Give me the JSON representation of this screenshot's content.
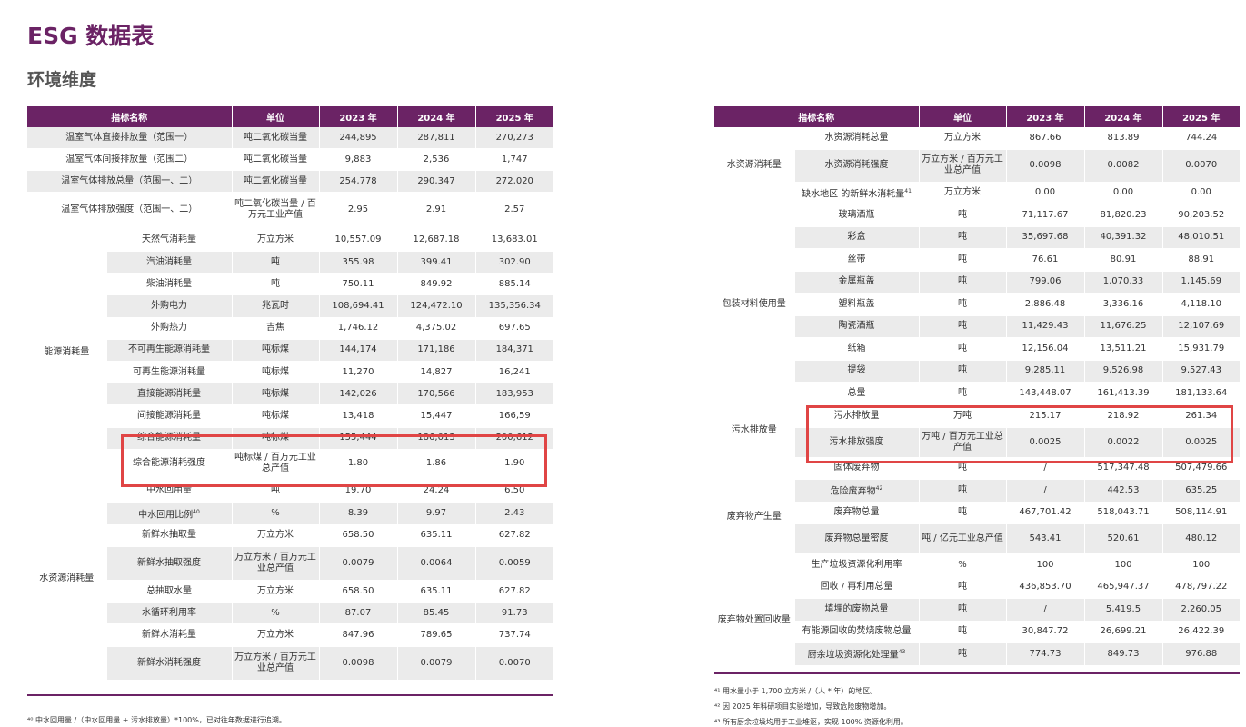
{
  "title": "ESG 数据表",
  "subtitle": "环境维度",
  "headers": {
    "indicator": "指标名称",
    "unit": "单位",
    "y2023": "2023 年",
    "y2024": "2024 年",
    "y2025": "2025 年"
  },
  "left": {
    "ghg": [
      {
        "name": "温室气体直接排放量（范围一）",
        "unit": "吨二氧化碳当量",
        "v2023": "244,895",
        "v2024": "287,811",
        "v2025": "270,273"
      },
      {
        "name": "温室气体间接排放量（范围二）",
        "unit": "吨二氧化碳当量",
        "v2023": "9,883",
        "v2024": "2,536",
        "v2025": "1,747"
      },
      {
        "name": "温室气体排放总量（范围一、二）",
        "unit": "吨二氧化碳当量",
        "v2023": "254,778",
        "v2024": "290,347",
        "v2025": "272,020"
      },
      {
        "name": "温室气体排放强度（范围一、二）",
        "unit": "吨二氧化碳当量 / 百万元工业产值",
        "v2023": "2.95",
        "v2024": "2.91",
        "v2025": "2.57"
      }
    ],
    "energy_group": "能源消耗量",
    "energy": [
      {
        "name": "天然气消耗量",
        "unit": "万立方米",
        "v2023": "10,557.09",
        "v2024": "12,687.18",
        "v2025": "13,683.01"
      },
      {
        "name": "汽油消耗量",
        "unit": "吨",
        "v2023": "355.98",
        "v2024": "399.41",
        "v2025": "302.90"
      },
      {
        "name": "柴油消耗量",
        "unit": "吨",
        "v2023": "750.11",
        "v2024": "849.92",
        "v2025": "885.14"
      },
      {
        "name": "外购电力",
        "unit": "兆瓦时",
        "v2023": "108,694.41",
        "v2024": "124,472.10",
        "v2025": "135,356.34"
      },
      {
        "name": "外购热力",
        "unit": "吉焦",
        "v2023": "1,746.12",
        "v2024": "4,375.02",
        "v2025": "697.65"
      },
      {
        "name": "不可再生能源消耗量",
        "unit": "吨标煤",
        "v2023": "144,174",
        "v2024": "171,186",
        "v2025": "184,371"
      },
      {
        "name": "可再生能源消耗量",
        "unit": "吨标煤",
        "v2023": "11,270",
        "v2024": "14,827",
        "v2025": "16,241"
      },
      {
        "name": "直接能源消耗量",
        "unit": "吨标煤",
        "v2023": "142,026",
        "v2024": "170,566",
        "v2025": "183,953"
      },
      {
        "name": "间接能源消耗量",
        "unit": "吨标煤",
        "v2023": "13,418",
        "v2024": "15,447",
        "v2025": "166,59"
      },
      {
        "name": "综合能源消耗量",
        "unit": "吨标煤",
        "v2023": "155,444",
        "v2024": "186,013",
        "v2025": "200,612"
      },
      {
        "name": "综合能源消耗强度",
        "unit": "吨标煤 / 百万元工业总产值",
        "v2023": "1.80",
        "v2024": "1.86",
        "v2025": "1.90"
      }
    ],
    "water_group": "水资源消耗量",
    "water": [
      {
        "name": "中水回用量",
        "sup": "",
        "unit": "吨",
        "v2023": "19.70",
        "v2024": "24.24",
        "v2025": "6.50"
      },
      {
        "name": "中水回用比例",
        "sup": "40",
        "unit": "%",
        "v2023": "8.39",
        "v2024": "9.97",
        "v2025": "2.43"
      },
      {
        "name": "新鲜水抽取量",
        "sup": "",
        "unit": "万立方米",
        "v2023": "658.50",
        "v2024": "635.11",
        "v2025": "627.82"
      },
      {
        "name": "新鲜水抽取强度",
        "sup": "",
        "unit": "万立方米 / 百万元工业总产值",
        "v2023": "0.0079",
        "v2024": "0.0064",
        "v2025": "0.0059"
      },
      {
        "name": "总抽取水量",
        "sup": "",
        "unit": "万立方米",
        "v2023": "658.50",
        "v2024": "635.11",
        "v2025": "627.82"
      },
      {
        "name": "水循环利用率",
        "sup": "",
        "unit": "%",
        "v2023": "87.07",
        "v2024": "85.45",
        "v2025": "91.73"
      },
      {
        "name": "新鲜水消耗量",
        "sup": "",
        "unit": "万立方米",
        "v2023": "847.96",
        "v2024": "789.65",
        "v2025": "737.74"
      },
      {
        "name": "新鲜水消耗强度",
        "sup": "",
        "unit": "万立方米 / 百万元工业总产值",
        "v2023": "0.0098",
        "v2024": "0.0079",
        "v2025": "0.0070"
      }
    ],
    "footnote": "⁴⁰ 中水回用量 /（中水回用量 + 污水排放量）*100%，已对往年数据进行追溯。"
  },
  "right": {
    "water_group": "水资源消耗量",
    "water": [
      {
        "name": "水资源消耗总量",
        "sup": "",
        "unit": "万立方米",
        "v2023": "867.66",
        "v2024": "813.89",
        "v2025": "744.24"
      },
      {
        "name": "水资源消耗强度",
        "sup": "",
        "unit": "万立方米 / 百万元工业总产值",
        "v2023": "0.0098",
        "v2024": "0.0082",
        "v2025": "0.0070"
      },
      {
        "name": "缺水地区 的新鲜水消耗量",
        "sup": "41",
        "unit": "万立方米",
        "v2023": "0.00",
        "v2024": "0.00",
        "v2025": "0.00"
      }
    ],
    "pack_group": "包装材料使用量",
    "pack": [
      {
        "name": "玻璃酒瓶",
        "unit": "吨",
        "v2023": "71,117.67",
        "v2024": "81,820.23",
        "v2025": "90,203.52"
      },
      {
        "name": "彩盒",
        "unit": "吨",
        "v2023": "35,697.68",
        "v2024": "40,391.32",
        "v2025": "48,010.51"
      },
      {
        "name": "丝带",
        "unit": "吨",
        "v2023": "76.61",
        "v2024": "80.91",
        "v2025": "88.91"
      },
      {
        "name": "金属瓶盖",
        "unit": "吨",
        "v2023": "799.06",
        "v2024": "1,070.33",
        "v2025": "1,145.69"
      },
      {
        "name": "塑料瓶盖",
        "unit": "吨",
        "v2023": "2,886.48",
        "v2024": "3,336.16",
        "v2025": "4,118.10"
      },
      {
        "name": "陶瓷酒瓶",
        "unit": "吨",
        "v2023": "11,429.43",
        "v2024": "11,676.25",
        "v2025": "12,107.69"
      },
      {
        "name": "纸箱",
        "unit": "吨",
        "v2023": "12,156.04",
        "v2024": "13,511.21",
        "v2025": "15,931.79"
      },
      {
        "name": "提袋",
        "unit": "吨",
        "v2023": "9,285.11",
        "v2024": "9,526.98",
        "v2025": "9,527.43"
      },
      {
        "name": "总量",
        "unit": "吨",
        "v2023": "143,448.07",
        "v2024": "161,413.39",
        "v2025": "181,133.64"
      }
    ],
    "sewage_group": "污水排放量",
    "sewage": [
      {
        "name": "污水排放量",
        "unit": "万吨",
        "v2023": "215.17",
        "v2024": "218.92",
        "v2025": "261.34"
      },
      {
        "name": "污水排放强度",
        "unit": "万吨 / 百万元工业总产值",
        "v2023": "0.0025",
        "v2024": "0.0022",
        "v2025": "0.0025"
      }
    ],
    "waste_group": "废弃物产生量",
    "waste": [
      {
        "name": "固体废弃物",
        "sup": "",
        "unit": "吨",
        "v2023": "/",
        "v2024": "517,347.48",
        "v2025": "507,479.66"
      },
      {
        "name": "危险废弃物",
        "sup": "42",
        "unit": "吨",
        "v2023": "/",
        "v2024": "442.53",
        "v2025": "635.25"
      },
      {
        "name": "废弃物总量",
        "sup": "",
        "unit": "吨",
        "v2023": "467,701.42",
        "v2024": "518,043.71",
        "v2025": "508,114.91"
      },
      {
        "name": "废弃物总量密度",
        "sup": "",
        "unit": "吨 / 亿元工业总产值",
        "v2023": "543.41",
        "v2024": "520.61",
        "v2025": "480.12"
      },
      {
        "name": "生产垃圾资源化利用率",
        "sup": "",
        "unit": "%",
        "v2023": "100",
        "v2024": "100",
        "v2025": "100"
      }
    ],
    "disposal_group": "废弃物处置回收量",
    "disposal": [
      {
        "name": "回收 / 再利用总量",
        "sup": "",
        "unit": "吨",
        "v2023": "436,853.70",
        "v2024": "465,947.37",
        "v2025": "478,797.22"
      },
      {
        "name": "填埋的废物总量",
        "sup": "",
        "unit": "吨",
        "v2023": "/",
        "v2024": "5,419.5",
        "v2025": "2,260.05"
      },
      {
        "name": "有能源回收的焚烧废物总量",
        "sup": "",
        "unit": "吨",
        "v2023": "30,847.72",
        "v2024": "26,699.21",
        "v2025": "26,422.39"
      },
      {
        "name": "厨余垃圾资源化处理量",
        "sup": "43",
        "unit": "吨",
        "v2023": "774.73",
        "v2024": "849.73",
        "v2025": "976.88"
      }
    ],
    "footnotes": [
      "⁴¹ 用水量小于 1,700 立方米 /（人 * 年）的地区。",
      "⁴² 因 2025 年科研项目实验增加，导致危险废物增加。",
      "⁴³ 所有厨余垃圾均用于工业堆沤，实现 100% 资源化利用。"
    ]
  },
  "colors": {
    "header": "#6b2365",
    "row_shade": "#ebebeb",
    "highlight": "#e04545"
  }
}
